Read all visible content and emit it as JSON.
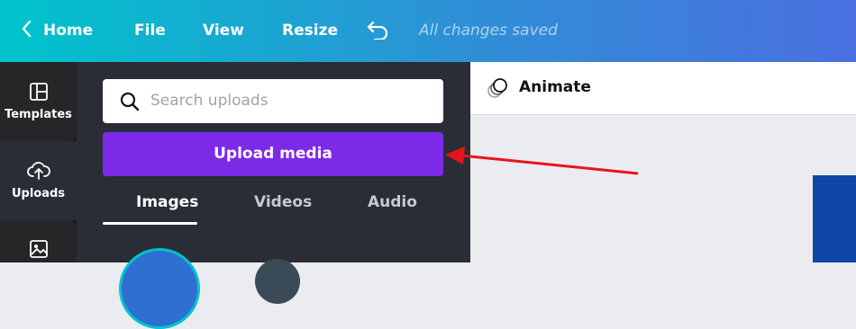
{
  "topbar": {
    "home_label": "Home",
    "menu": [
      "File",
      "View",
      "Resize"
    ],
    "status": "All changes saved"
  },
  "rail": {
    "items": [
      {
        "label": "Templates",
        "icon": "templates-icon"
      },
      {
        "label": "Uploads",
        "icon": "upload-cloud-icon"
      },
      {
        "label": "",
        "icon": "photos-icon"
      }
    ]
  },
  "panel": {
    "search_placeholder": "Search uploads",
    "upload_button": "Upload media",
    "tabs": [
      "Images",
      "Videos",
      "Audio"
    ],
    "active_tab": "Images"
  },
  "editor": {
    "animate_label": "Animate"
  },
  "colors": {
    "brand_purple": "#7d2ae8",
    "gradient_start": "#00c4cc",
    "gradient_end": "#4a6fe0",
    "annotation_arrow": "#e8141c"
  }
}
